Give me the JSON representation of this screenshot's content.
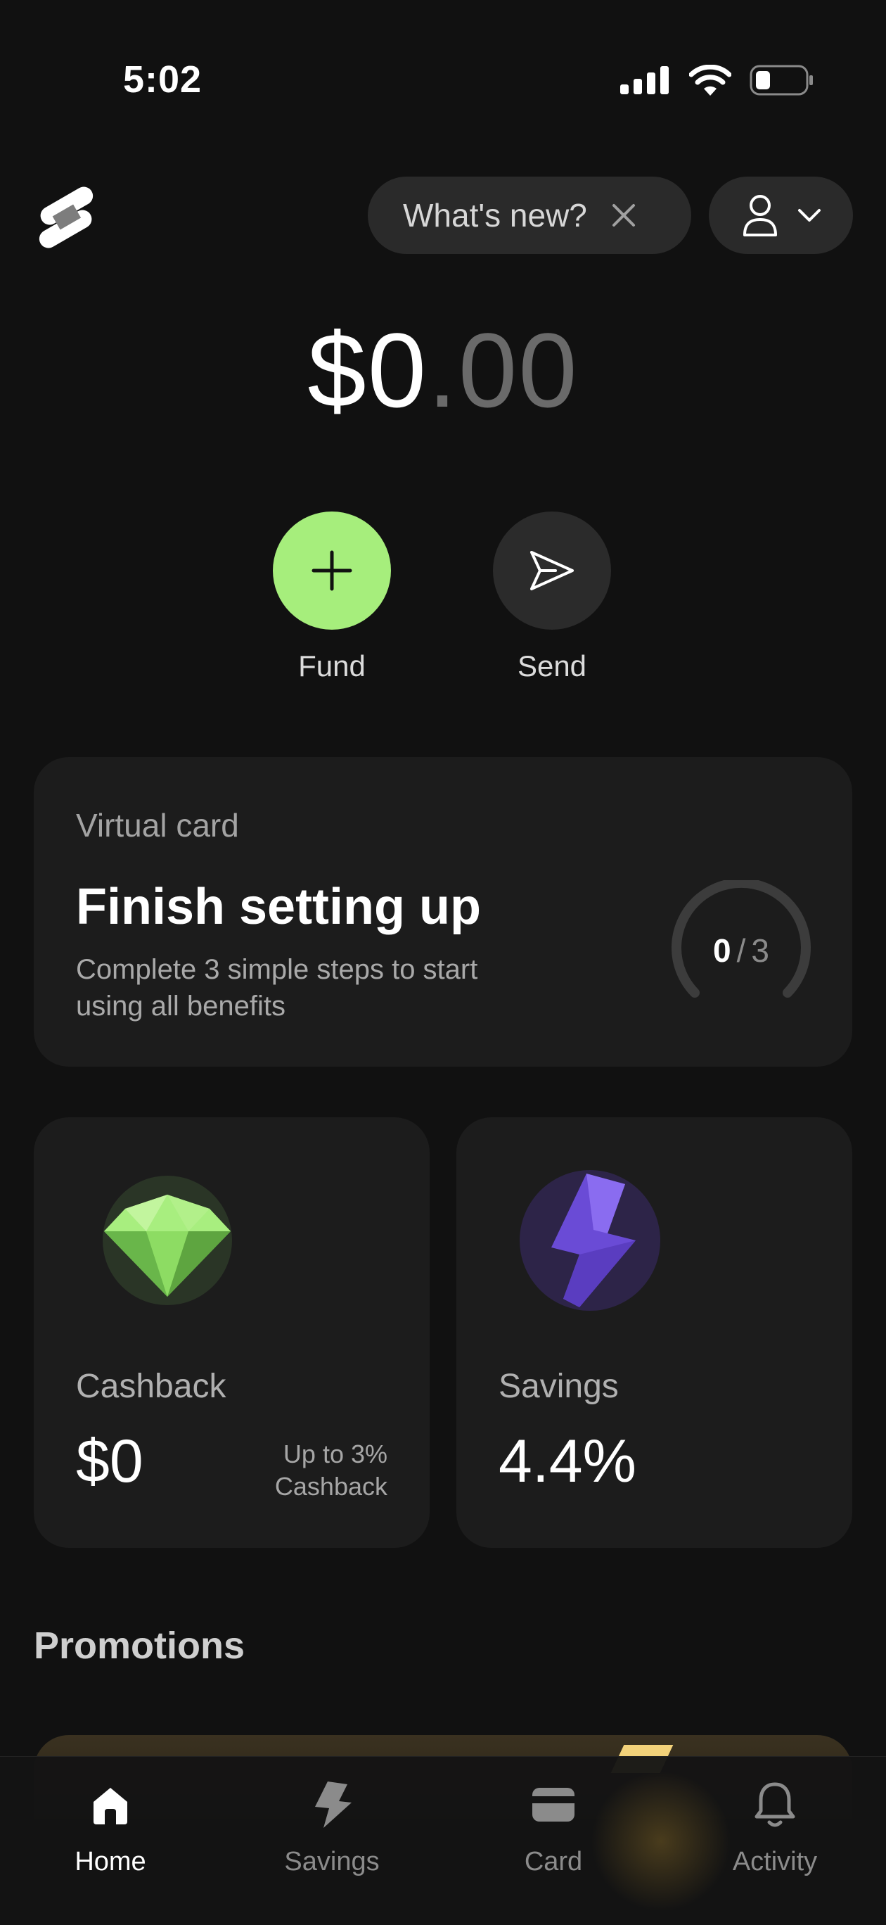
{
  "status_bar": {
    "time": "5:02"
  },
  "header": {
    "whats_new_label": "What's new?"
  },
  "balance": {
    "dollars": "$0",
    "dot": ".",
    "cents": "00"
  },
  "actions": [
    {
      "label": "Fund",
      "icon": "plus-icon",
      "color": "#a6ee7c"
    },
    {
      "label": "Send",
      "icon": "send-icon",
      "color": "#2b2b2b"
    }
  ],
  "virtual_card": {
    "kicker": "Virtual card",
    "title": "Finish setting up",
    "description": "Complete 3 simple steps to start using all benefits",
    "progress_done": "0",
    "progress_sep": "/",
    "progress_total": "3"
  },
  "cashback": {
    "name": "Cashback",
    "value": "$0",
    "note_line1": "Up to 3%",
    "note_line2": "Cashback",
    "icon": "gem-icon"
  },
  "savings": {
    "name": "Savings",
    "value": "4.4%",
    "icon": "lightning-icon"
  },
  "promotions": {
    "title": "Promotions"
  },
  "tabs": [
    {
      "label": "Home",
      "icon": "home-icon",
      "active": true
    },
    {
      "label": "Savings",
      "icon": "lightning-icon",
      "active": false
    },
    {
      "label": "Card",
      "icon": "card-icon",
      "active": false
    },
    {
      "label": "Activity",
      "icon": "bell-icon",
      "active": false
    }
  ],
  "colors": {
    "accent": "#a6ee7c",
    "background": "#111111",
    "card": "#1c1c1c"
  }
}
